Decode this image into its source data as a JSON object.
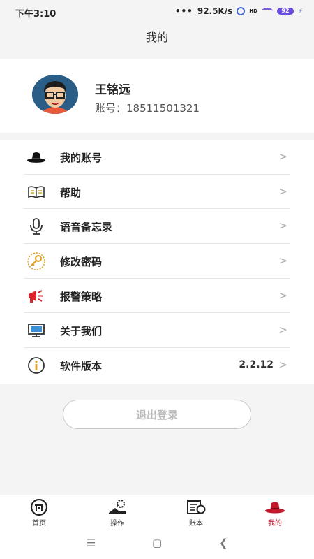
{
  "status_bar": {
    "time": "下午3:10",
    "dots": "•••",
    "speed": "92.5K/s",
    "hd": "HD",
    "battery": "92"
  },
  "header": {
    "title": "我的"
  },
  "profile": {
    "name": "王铭远",
    "account": "账号：18511501321"
  },
  "menu": [
    {
      "label": "我的账号",
      "icon": "hat-icon"
    },
    {
      "label": "帮助",
      "icon": "book-icon"
    },
    {
      "label": "语音备忘录",
      "icon": "microphone-icon"
    },
    {
      "label": "修改密码",
      "icon": "key-icon"
    },
    {
      "label": "报警策略",
      "icon": "megaphone-icon"
    },
    {
      "label": "关于我们",
      "icon": "monitor-icon"
    },
    {
      "label": "软件版本",
      "icon": "info-icon",
      "value": "2.2.12"
    }
  ],
  "chevron": ">",
  "logout_label": "退出登录",
  "tabs": [
    {
      "label": "首页",
      "icon": "home-coin-icon"
    },
    {
      "label": "操作",
      "icon": "operation-icon"
    },
    {
      "label": "账本",
      "icon": "ledger-icon"
    },
    {
      "label": "我的",
      "icon": "hat-icon",
      "active": true
    }
  ],
  "colors": {
    "accent": "#c0192b",
    "avatar_bg": "#2a5e86",
    "key": "#e0a020",
    "megaphone": "#d8262c"
  }
}
